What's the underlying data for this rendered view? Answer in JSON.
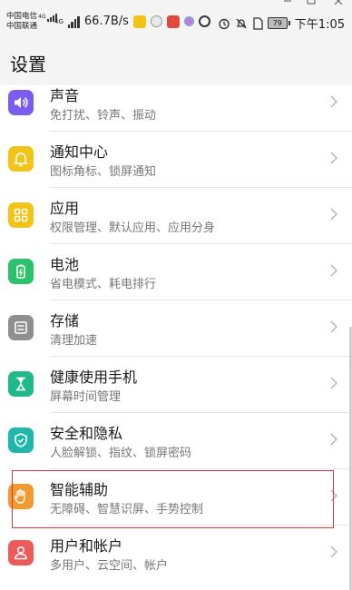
{
  "statusbar": {
    "carrier1": "中国电信",
    "carrier1_net": "4G",
    "carrier2": "中国联通",
    "carrier2_net": "4G",
    "net_speed": "66.7B/s",
    "battery_level": "79",
    "time": "下午1:05"
  },
  "header": {
    "title": "设置"
  },
  "items": [
    {
      "title": "声音",
      "subtitle": "免打扰、铃声、振动",
      "icon": "speaker-icon",
      "color": "#7b5cf0"
    },
    {
      "title": "通知中心",
      "subtitle": "图标角标、锁屏通知",
      "icon": "bell-icon",
      "color": "#f2c418"
    },
    {
      "title": "应用",
      "subtitle": "权限管理、默认应用、应用分身",
      "icon": "apps-grid-icon",
      "color": "#f2c418"
    },
    {
      "title": "电池",
      "subtitle": "省电模式、耗电排行",
      "icon": "battery-icon",
      "color": "#2bc26b"
    },
    {
      "title": "存储",
      "subtitle": "清理加速",
      "icon": "storage-icon",
      "color": "#8f8f8f"
    },
    {
      "title": "健康使用手机",
      "subtitle": "屏幕时间管理",
      "icon": "hourglass-icon",
      "color": "#21b98a"
    },
    {
      "title": "安全和隐私",
      "subtitle": "人脸解锁、指纹、锁屏密码",
      "icon": "shield-icon",
      "color": "#1fb6ac"
    },
    {
      "title": "智能辅助",
      "subtitle": "无障碍、智慧识屏、手势控制",
      "icon": "hand-icon",
      "color": "#f29a2e"
    },
    {
      "title": "用户和帐户",
      "subtitle": "多用户、云空间、帐户",
      "icon": "user-icon",
      "color": "#ee5a5a"
    }
  ]
}
